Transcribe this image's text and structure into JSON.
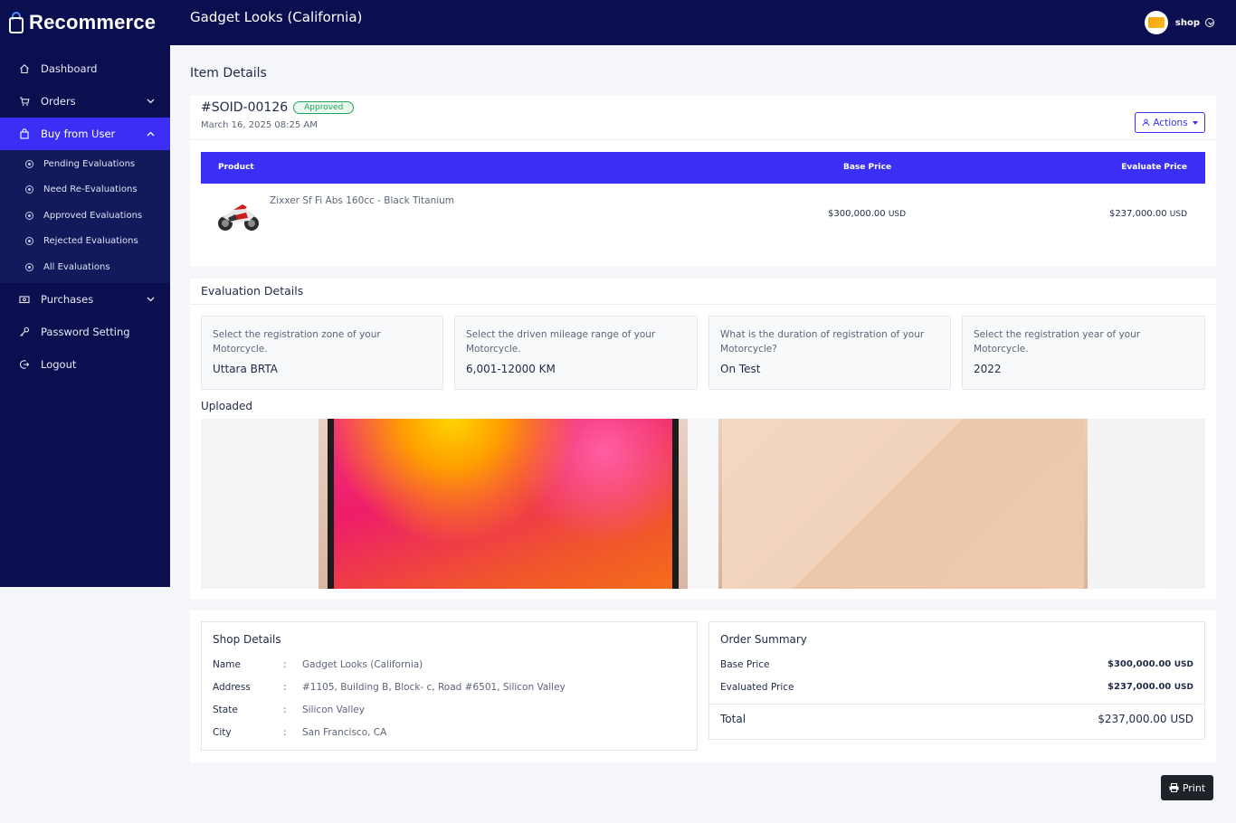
{
  "brand": {
    "name": "Recommerce"
  },
  "header": {
    "title": "Gadget Looks (California)",
    "user": "shop"
  },
  "sidebar": {
    "items": [
      {
        "label": "Dashboard",
        "icon": "home-icon"
      },
      {
        "label": "Orders",
        "icon": "cart-icon"
      },
      {
        "label": "Buy from User",
        "icon": "bag-icon"
      },
      {
        "label": "Purchases",
        "icon": "money-icon"
      },
      {
        "label": "Password Setting",
        "icon": "key-icon"
      },
      {
        "label": "Logout",
        "icon": "logout-icon"
      }
    ],
    "submenu": [
      {
        "label": "Pending Evaluations"
      },
      {
        "label": "Need Re-Evaluations"
      },
      {
        "label": "Approved Evaluations"
      },
      {
        "label": "Rejected Evaluations"
      },
      {
        "label": "All Evaluations"
      }
    ],
    "colors": {
      "bg": "#0b0f4f",
      "active": "#3b2ff6"
    }
  },
  "page": {
    "title": "Item Details"
  },
  "order": {
    "id": "#SOID-00126",
    "status": "Approved",
    "date": "March 16, 2025 08:25 AM",
    "actions_label": "Actions"
  },
  "products": {
    "headers": {
      "product": "Product",
      "base": "Base Price",
      "evaluate": "Evaluate Price"
    },
    "rows": [
      {
        "name": "Zixxer Sf Fi Abs 160cc - Black Titanium",
        "base": "$300,000.00",
        "base_cur": "USD",
        "evaluate": "$237,000.00",
        "evaluate_cur": "USD"
      }
    ]
  },
  "evaluation": {
    "title": "Evaluation Details",
    "questions": [
      {
        "q": "Select the registration zone of your Motorcycle.",
        "a": "Uttara BRTA"
      },
      {
        "q": "Select the driven mileage range of your Motorcycle.",
        "a": "6,001-12000 KM"
      },
      {
        "q": "What is the duration of registration of your Motorcycle?",
        "a": "On Test"
      },
      {
        "q": "Select the registration year of your Motorcycle.",
        "a": "2022"
      }
    ],
    "uploaded_label": "Uploaded"
  },
  "shop": {
    "title": "Shop Details",
    "fields": [
      {
        "k": "Name",
        "sep": ":",
        "v": "Gadget Looks (California)"
      },
      {
        "k": "Address",
        "sep": ":",
        "v": "#1105, Building B, Block- c, Road #6501, Silicon Valley"
      },
      {
        "k": "State",
        "sep": ":",
        "v": "Silicon Valley"
      },
      {
        "k": "City",
        "sep": ":",
        "v": "San Francisco, CA"
      }
    ]
  },
  "summary": {
    "title": "Order Summary",
    "base_label": "Base Price",
    "base_value": "$300,000.00",
    "base_cur": "USD",
    "eval_label": "Evaluated Price",
    "eval_value": "$237,000.00",
    "eval_cur": "USD",
    "total_label": "Total",
    "total_value": "$237,000.00 USD"
  },
  "print_label": "Print"
}
